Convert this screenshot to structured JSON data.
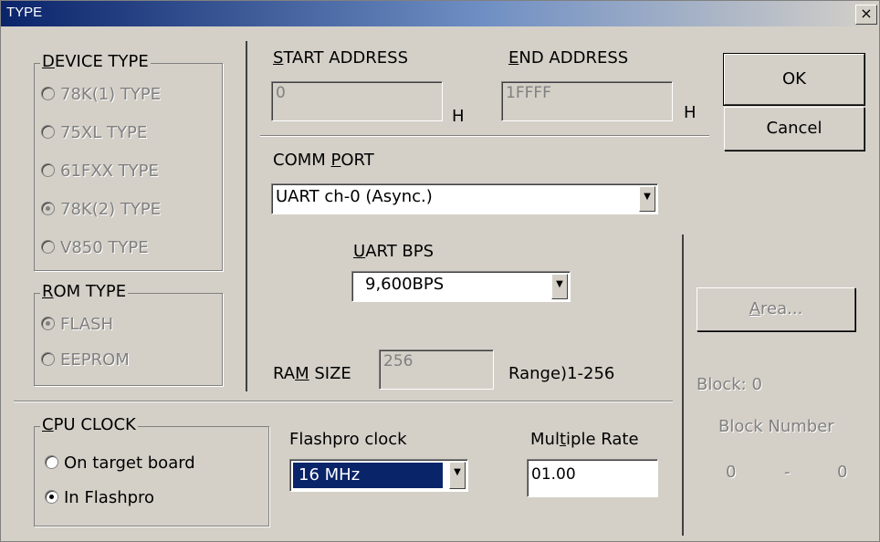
{
  "window": {
    "title": "TYPE",
    "close_glyph": "×"
  },
  "device_type": {
    "legend_accel": "D",
    "legend_rest": "EVICE TYPE",
    "options": [
      {
        "label": "78K(1) TYPE",
        "checked": false
      },
      {
        "label": "75XL TYPE",
        "checked": false
      },
      {
        "label": "61FXX TYPE",
        "checked": false
      },
      {
        "label": "78K(2) TYPE",
        "checked": true
      },
      {
        "label": "V850 TYPE",
        "checked": false
      }
    ]
  },
  "rom_type": {
    "legend_accel": "R",
    "legend_rest": "OM TYPE",
    "options": [
      {
        "label": "FLASH",
        "checked": true
      },
      {
        "label": "EEPROM",
        "checked": false
      }
    ]
  },
  "cpu_clock": {
    "legend_accel": "C",
    "legend_rest": "PU CLOCK",
    "options": [
      {
        "label": "On target board",
        "checked": false
      },
      {
        "label": "In Flashpro",
        "checked": true
      }
    ]
  },
  "start_address": {
    "label_accel": "S",
    "label_rest": "TART ADDRESS",
    "value": "0",
    "suffix": "H"
  },
  "end_address": {
    "label_accel": "E",
    "label_rest": "ND ADDRESS",
    "value": "1FFFF",
    "suffix": "H"
  },
  "comm_port": {
    "label_pre": "COMM ",
    "label_accel": "P",
    "label_rest": "ORT",
    "value": "UART ch-0 (Async.)"
  },
  "uart_bps": {
    "label_accel": "U",
    "label_rest": "ART BPS",
    "value": "9,600BPS"
  },
  "ram_size": {
    "label_pre": "RA",
    "label_accel": "M",
    "label_rest": " SIZE",
    "value": "256",
    "range": "Range)1-256"
  },
  "flashpro_clock": {
    "label_accel": "F",
    "label_rest": "lashpro clock",
    "value": "16  MHz"
  },
  "multiple_rate": {
    "label_pre": "Mul",
    "label_accel": "t",
    "label_rest": "iple Rate",
    "value": "01.00"
  },
  "buttons": {
    "ok": "OK",
    "cancel": "Cancel",
    "area_accel": "A",
    "area_rest": "rea..."
  },
  "block": {
    "block_label": "Block:",
    "block_value": "0",
    "number_label": "Block Number",
    "from": "0",
    "dash": "-",
    "to": "0"
  },
  "icons": {
    "combo_arrow": "▼"
  }
}
